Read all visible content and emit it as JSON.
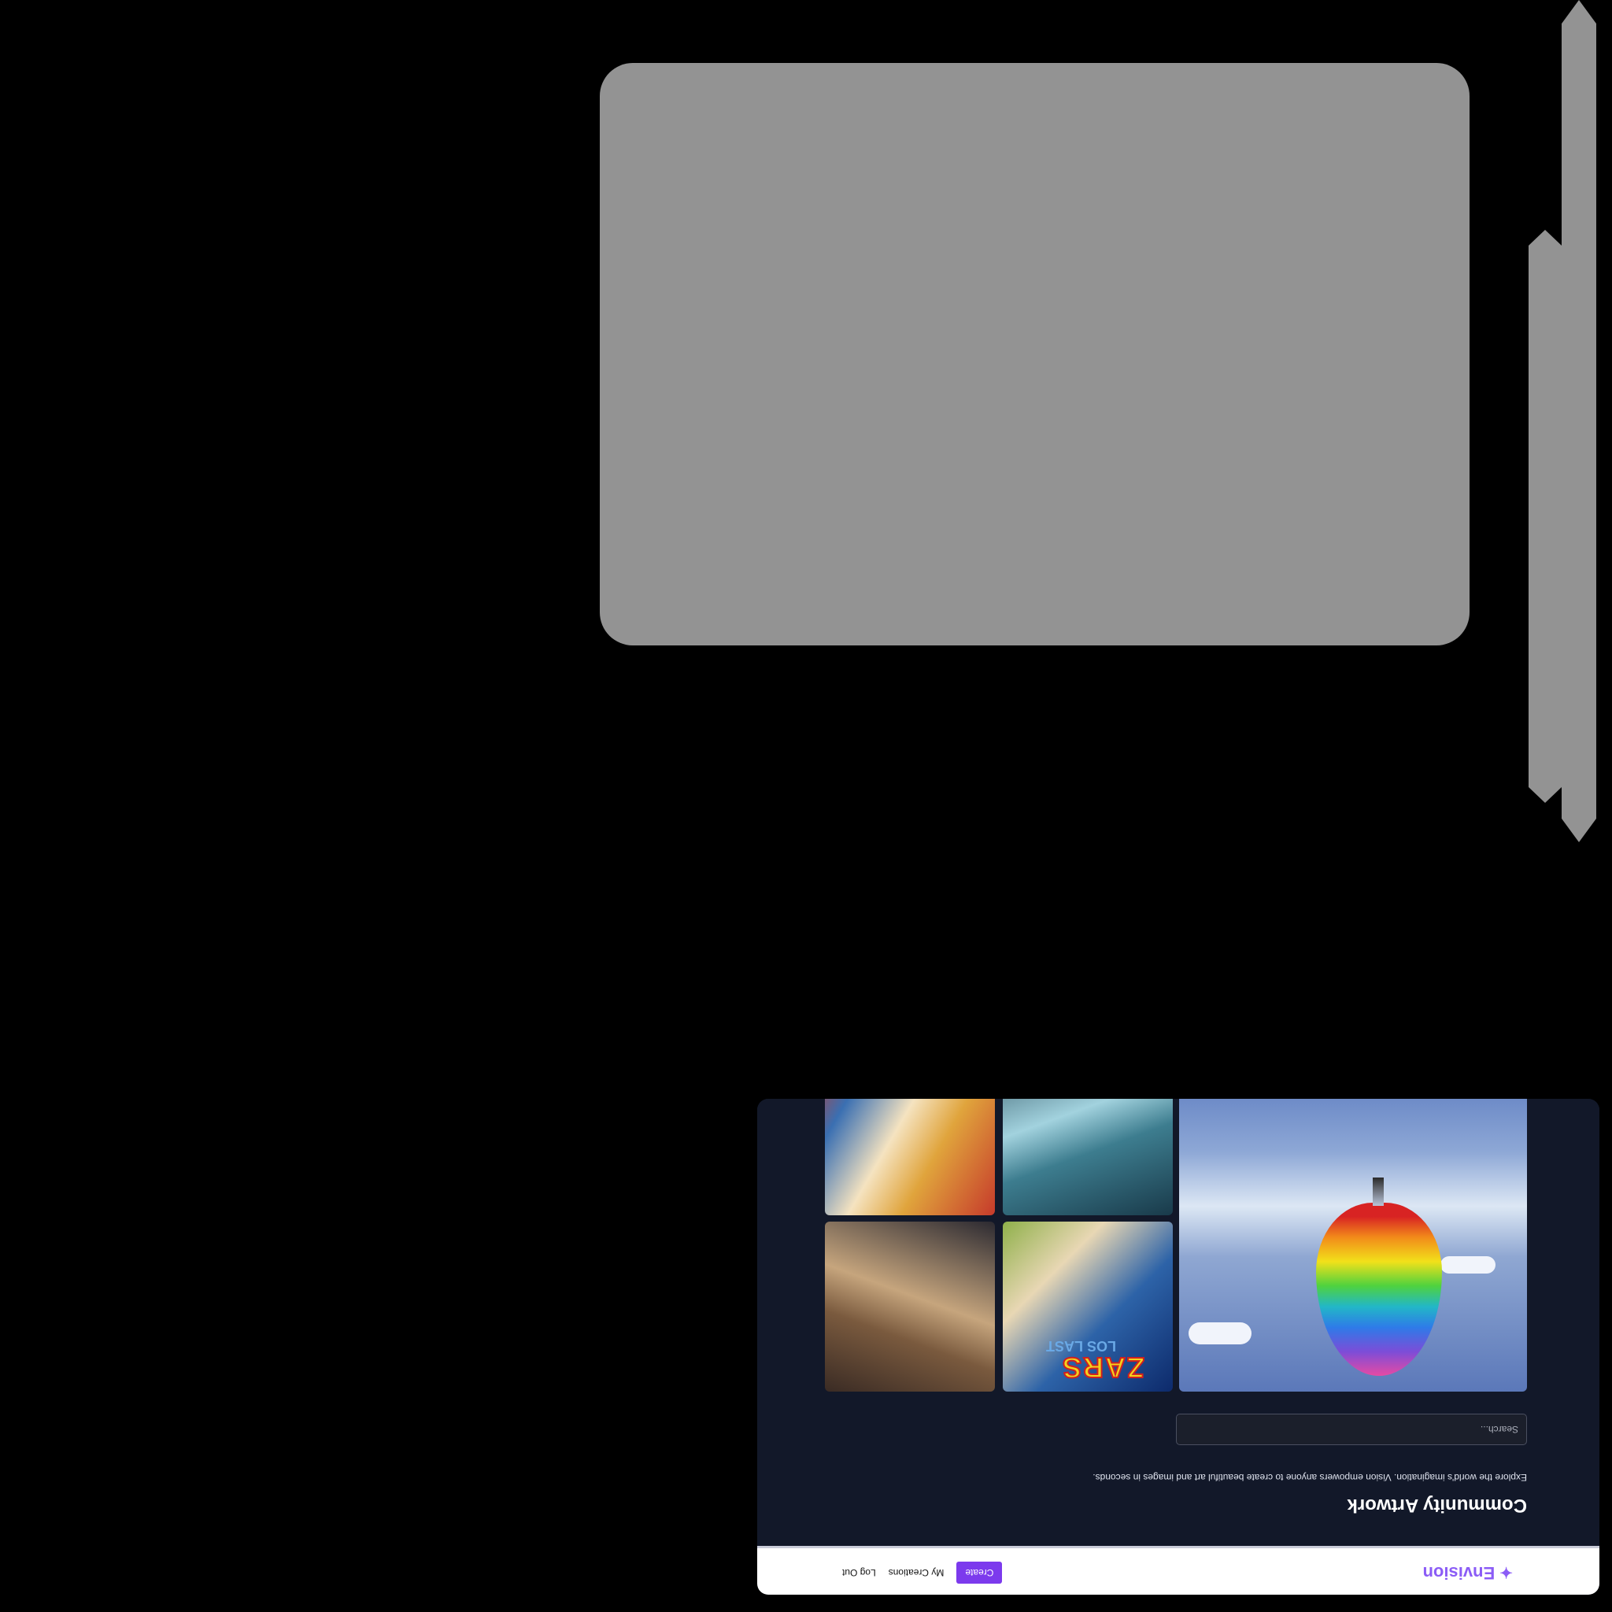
{
  "navbar": {
    "brand_icon": "sparkle-icon",
    "brand": "Envision",
    "create_label": "Create",
    "my_creations_label": "My Creations",
    "logout_label": "Log Out"
  },
  "main": {
    "heading": "Community Artwork",
    "subtitle": "Explore the world's imagination. Vision empowers anyone to create beautiful art and images in seconds.",
    "search_placeholder": "Search..."
  },
  "gallery": {
    "manga_title": "ZARS",
    "manga_subtitle": "LOS LAST"
  },
  "colors": {
    "accent": "#7c3aed",
    "brand": "#8b5cf6",
    "background": "#121829",
    "panel": "#939393"
  }
}
